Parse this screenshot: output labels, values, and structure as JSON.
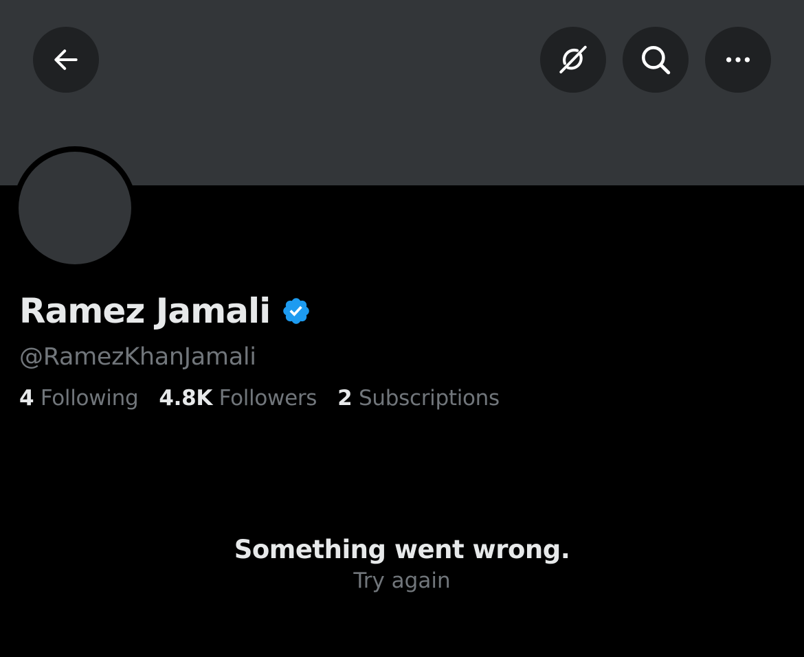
{
  "colors": {
    "background": "#000000",
    "banner": "#333639",
    "avatar_placeholder": "#333639",
    "icon_button_bg": "#1f2123",
    "primary_text": "#e7e9ea",
    "secondary_text": "#71767b",
    "verified_blue": "#1d9bf0"
  },
  "header": {
    "back_icon": "arrow-left-icon",
    "grok_icon": "grok-icon",
    "search_icon": "search-icon",
    "more_icon": "more-horizontal-icon"
  },
  "profile": {
    "display_name": "Ramez Jamali",
    "verified_icon": "verified-badge-icon",
    "handle": "@RamezKhanJamali",
    "stats": [
      {
        "count": "4",
        "label": "Following"
      },
      {
        "count": "4.8K",
        "label": "Followers"
      },
      {
        "count": "2",
        "label": "Subscriptions"
      }
    ]
  },
  "error": {
    "message": "Something went wrong.",
    "retry_label": "Try again"
  }
}
